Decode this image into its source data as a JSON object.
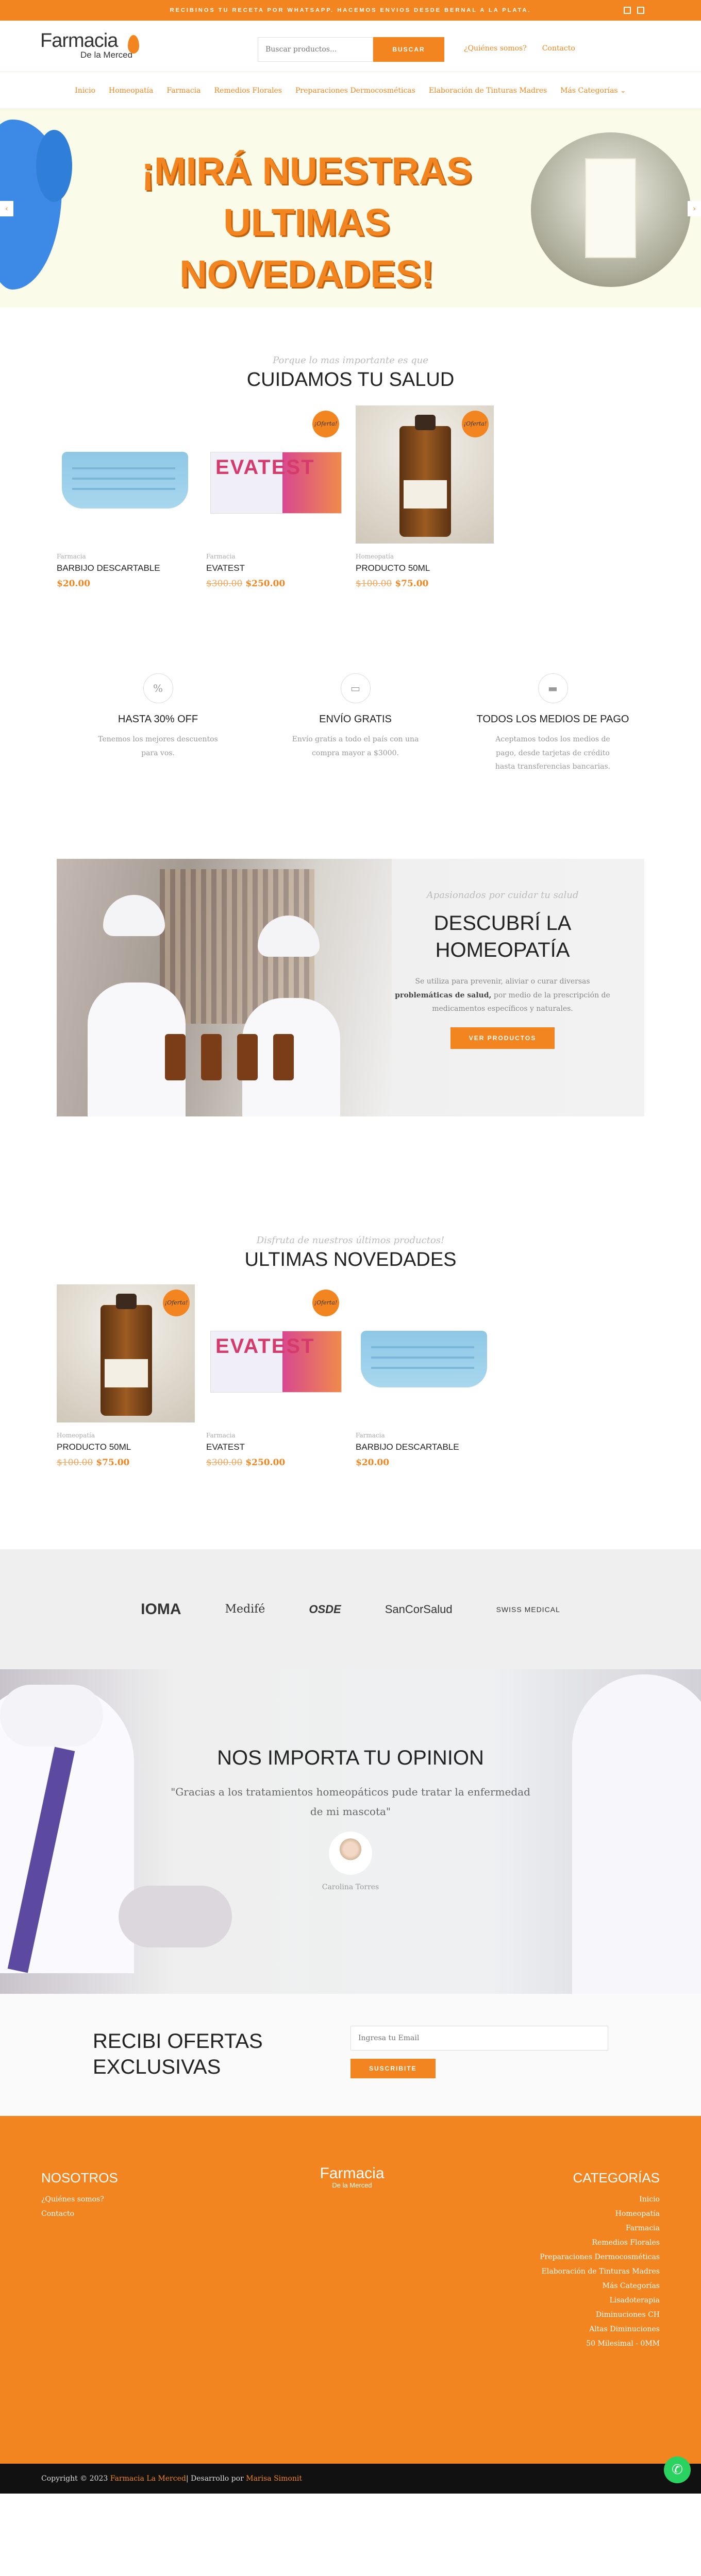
{
  "topbar": {
    "announcement": "RECIBINOS TU RECETA POR WHATSAPP. HACEMOS ENVIOS DESDE BERNAL A LA PLATA.",
    "social_icons": [
      "instagram-icon",
      "facebook-icon"
    ]
  },
  "header": {
    "logo_line1": "Farmacia",
    "logo_line2": "De la Merced",
    "search": {
      "placeholder": "Buscar productos...",
      "button": "BUSCAR"
    },
    "links": [
      "¿Quiénes somos?",
      "Contacto"
    ]
  },
  "nav": {
    "items": [
      "Inicio",
      "Homeopatía",
      "Farmacia",
      "Remedios Florales",
      "Preparaciones Dermocosméticas",
      "Elaboración de Tinturas Madres",
      "Más Categorías"
    ],
    "more_icon": "chevron-down-icon"
  },
  "hero": {
    "headline_line1": "¡MIRÁ NUESTRAS",
    "headline_line2": "ULTIMAS NOVEDADES!",
    "prev_icon": "chevron-left-icon",
    "next_icon": "chevron-right-icon"
  },
  "salud": {
    "script": "Porque lo mas importante es que",
    "title": "CUIDAMOS TU SALUD",
    "products": [
      {
        "badge": "",
        "category": "Farmacia",
        "name": "BARBIJO DESCARTABLE",
        "old_price": "",
        "price": "$20.00"
      },
      {
        "badge": "¡Oferta!",
        "category": "Farmacia",
        "name": "EVATEST",
        "old_price": "$300.00",
        "price": "$250.00"
      },
      {
        "badge": "¡Oferta!",
        "category": "Homeopatía",
        "name": "PRODUCTO 50ML",
        "old_price": "$100.00",
        "price": "$75.00"
      }
    ]
  },
  "features": [
    {
      "icon": "percent-icon",
      "title": "HASTA 30% OFF",
      "text": "Tenemos los mejores descuentos para vos."
    },
    {
      "icon": "truck-icon",
      "title": "ENVÍO GRATIS",
      "text": "Envío gratis a todo el país con una compra mayor a $3000."
    },
    {
      "icon": "credit-card-icon",
      "title": "TODOS LOS MEDIOS DE PAGO",
      "text": "Aceptamos todos los medios de pago, desde tarjetas de crédito hasta transferencias bancarias."
    }
  ],
  "homeopatia": {
    "script": "Apasionados por cuidar tu salud",
    "title_line1": "DESCUBRÍ LA",
    "title_line2": "HOMEOPATÍA",
    "text_before": "Se utiliza para prevenir, aliviar o curar diversas ",
    "text_bold": "problemáticas de salud,",
    "text_after": " por medio de la prescripción de medicamentos específicos y naturales.",
    "button": "VER PRODUCTOS"
  },
  "novedades": {
    "script": "Disfruta de nuestros últimos productos!",
    "title": "ULTIMAS NOVEDADES",
    "products": [
      {
        "badge": "¡Oferta!",
        "category": "Homeopatía",
        "name": "PRODUCTO 50ML",
        "old_price": "$100.00",
        "price": "$75.00"
      },
      {
        "badge": "¡Oferta!",
        "category": "Farmacia",
        "name": "EVATEST",
        "old_price": "$300.00",
        "price": "$250.00"
      },
      {
        "badge": "",
        "category": "Farmacia",
        "name": "BARBIJO DESCARTABLE",
        "old_price": "",
        "price": "$20.00"
      }
    ]
  },
  "brands": [
    "IOMA",
    "Medifé",
    "OSDE",
    "SanCorSalud",
    "SWISS MEDICAL"
  ],
  "testimonial": {
    "title": "NOS IMPORTA TU OPINION",
    "quote": "\"Gracias a los tratamientos homeopáticos pude tratar la enfermedad de mi mascota\"",
    "author": "Carolina Torres"
  },
  "newsletter": {
    "title": "RECIBI OFERTAS EXCLUSIVAS",
    "placeholder": "Ingresa tu Email",
    "button": "SUSCRIBITE"
  },
  "footer": {
    "col1_title": "NOSOTROS",
    "col1_links": [
      "¿Quiénes somos?",
      "Contacto"
    ],
    "logo_line1": "Farmacia",
    "logo_line2": "De la Merced",
    "col3_title": "CATEGORÍAS",
    "col3_links": [
      "Inicio",
      "Homeopatía",
      "Farmacia",
      "Remedios Florales",
      "Preparaciones Dermocosméticas",
      "Elaboración de Tinturas Madres",
      "Más Categorías",
      "Lisadoterapia",
      "Diminuciones CH",
      "Altas Diminuciones",
      "50 Milesimal - 0MM"
    ]
  },
  "copyright": {
    "prefix": "Copyright © 2023 ",
    "shop": "Farmacia La Merced",
    "middle": " | Desarrollo por ",
    "dev": "Marisa Simonit"
  },
  "whatsapp_icon": "whatsapp-icon",
  "colors": {
    "accent": "#f2851f",
    "dark": "#111111"
  }
}
